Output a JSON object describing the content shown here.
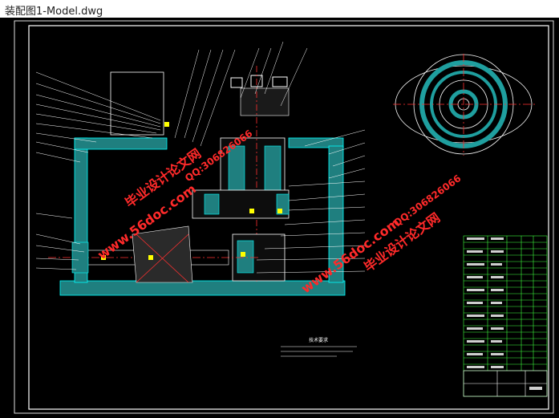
{
  "window": {
    "title": "装配图1-Model.dwg"
  },
  "drawing": {
    "background_color": "#000000",
    "frame_color": "#ffffff",
    "tech_requirements_title": "技术要求"
  },
  "watermarks": {
    "site": "www.56doc.com",
    "qq": "QQ:306826066",
    "brand": "毕业设计论文网",
    "color": "#ff2a2a"
  }
}
